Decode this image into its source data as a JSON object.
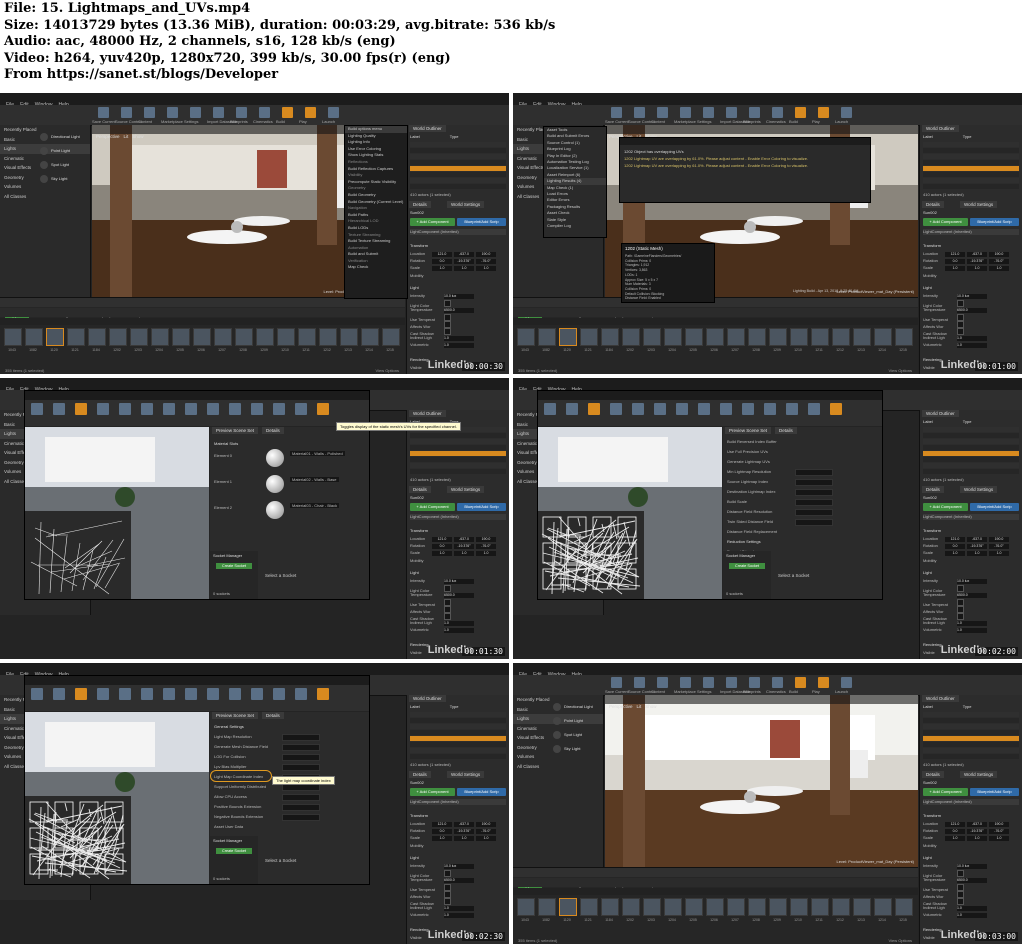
{
  "header": {
    "file": "File: 15. Lightmaps_and_UVs.mp4",
    "size": "Size: 14013729 bytes (13.36 MiB), duration: 00:03:29, avg.bitrate: 536 kb/s",
    "audio": "Audio: aac, 48000 Hz, 2 channels, s16, 128 kb/s (eng)",
    "video": "Video: h264, yuv420p, 1280x720, 399 kb/s, 30.00 fps(r) (eng)",
    "source": "From https://sanet.st/blogs/Developer"
  },
  "common": {
    "menu": [
      "File",
      "Edit",
      "Window",
      "Help"
    ],
    "toolbar_labels": [
      "Save Current",
      "Source Control",
      "Content",
      "Marketplace",
      "Settings",
      "Import Datasmith",
      "Blueprints",
      "Cinematics",
      "Build",
      "Play",
      "Launch"
    ],
    "left_categories": [
      "Recently Placed",
      "Basic",
      "Lights",
      "Cinematic",
      "Visual Effects",
      "Geometry",
      "Volumes",
      "All Classes"
    ],
    "light_items": [
      "Directional Light",
      "Point Light",
      "Spot Light",
      "Sky Light"
    ],
    "viewport_tabs": [
      "Perspective",
      "Lit",
      "Show"
    ],
    "level_label": "Level:  ProductViewer_mat_Day (Persistent)",
    "content_tabs": [
      "Content Browser",
      "Output Log"
    ],
    "cb_buttons": [
      "Add New",
      "Import",
      "Save All"
    ],
    "cb_path": [
      "Content",
      "neFlanders",
      "Geometries"
    ],
    "filters": "Filters",
    "items_status": "355 items (1 selected)",
    "view_options": "View Options",
    "asset_labels": [
      "1043",
      "1082",
      "1120",
      "1121",
      "1184",
      "1202",
      "1203",
      "1204",
      "1205",
      "1206",
      "1207",
      "1208",
      "1209",
      "1210",
      "1211",
      "1212",
      "1213",
      "1214",
      "1215"
    ],
    "world_outliner": "World Outliner",
    "outliner_cols": [
      "Label",
      "Type"
    ],
    "details_tab": "Details",
    "world_settings": "World Settings",
    "sun_label": "Sun002",
    "add_component": "+ Add Component",
    "blueprint_script": "Blueprint/Add Scrip",
    "light_component": "LightComponent (Inherited)",
    "transform": "Transform",
    "location": "Location",
    "rotation": "Rotation",
    "scale": "Scale",
    "mobility": "Mobility",
    "light": "Light",
    "intensity": "Intensity",
    "light_color": "Light Color",
    "temperature": "Temperature",
    "use_temperature": "Use Temperat",
    "affects_world": "Affects Wor",
    "cast_shadows": "Cast Shadow",
    "indirect_light": "Indirect Ligh",
    "volumetric": "Volumetric",
    "rendering": "Rendering",
    "visible": "Visible",
    "actors_count": "410 actors (1 selected)",
    "values": {
      "loc": [
        "121.0",
        "-637.0",
        "190.0"
      ],
      "rot": [
        "0.0",
        "-19.376°",
        "-76.0°"
      ],
      "scl": [
        "1.0",
        "1.0",
        "1.0"
      ],
      "intensity": "10.0 lux",
      "temperature": "6500.0",
      "indirect": "1.0",
      "volumetric": "1.0"
    },
    "linkedin": "LinkedIn"
  },
  "frames": [
    {
      "timestamp": "00:00:30",
      "build_menu": [
        "Build options menu",
        "Lighting Quality",
        "Lighting Info",
        "Use Error Coloring",
        "Show Lighting Stats",
        "Reflections",
        "Build Reflection Captures",
        "Visibility",
        "Precompute Static Visibility",
        "Geometry",
        "Build Geometry",
        "Build Geometry (Current Level)",
        "Navigation",
        "Build Paths",
        "Hierarchical LOD",
        "Build LODs",
        "Texture Streaming",
        "Build Texture Streaming",
        "Automation",
        "Build and Submit",
        "Verification",
        "Map Check"
      ]
    },
    {
      "timestamp": "00:01:00",
      "window_menu": [
        "Asset Tools",
        "Build and Submit Errors",
        "Source Control (1)",
        "Blueprint Log",
        "Play In Editor (2)",
        "Automation Testing Log",
        "Localization Service (1)",
        "Asset Reimport (6)",
        "Lighting Results (4)",
        "Map Check (1)",
        "Load Errors",
        "Editor Errors",
        "Packaging Results",
        "Asset Check",
        "Slate Style",
        "Compiler Log"
      ],
      "log_lines": [
        "1202 Object has overlapping UVs",
        "1202 Lightmap UV are overlapping by 61.0%. Please adjust content - Enable Error Coloring to visualize.",
        "1202 Lightmap UV are overlapping by 61.0%. Please adjust content - Enable Error Coloring to visualize."
      ],
      "tooltip_title": "1202 (Static Mesh)",
      "tooltip_lines": [
        "Path: /Game/neFlanders/Geometries/",
        "Collision Prims: 0",
        "Triangles: 1,912",
        "Vertices: 3,863",
        "LODs: 1",
        "Approx Size: 5 x 5 x 7",
        "Num Materials: 3",
        "Collision Prims: 0",
        "Default Collision: Blocking",
        "Distance Field: Enabled"
      ],
      "lighting_build": "Lighting Build - Apr 13, 2018, 9:23:40 AM"
    },
    {
      "timestamp": "00:01:30",
      "sme_title": "1202",
      "sme_tabs": [
        "Preview Scene Set",
        "Details"
      ],
      "toggle_tip": "Toggles display of the static mesh's UVs for the specified channel.",
      "material_slots": "Material Slots",
      "element_labels": [
        "Element 0",
        "Element 1",
        "Element 2"
      ],
      "material_names": [
        "Material01 - Walls - Polished",
        "Material02 - Walls - Base",
        "Material03 - Chair - Black"
      ],
      "socket_manager": "Socket Manager",
      "create_socket": "Create Socket",
      "select_socket": "Select a Socket",
      "sockets": "0 sockets"
    },
    {
      "timestamp": "00:02:00",
      "props": [
        "Build Reversed Index Buffer",
        "Use Full Precision UVs",
        "Generate Lightmap UVs",
        "Min Lightmap Resolution",
        "Source Lightmap Index",
        "Destination Lightmap Index",
        "Build Scale",
        "Distance Field Resolution",
        "Twin Sided Distance Field",
        "Distance Field Replacement",
        "Reduction Settings",
        "Percent Triangles"
      ],
      "vals": [
        "64",
        "0",
        "1",
        "1.0",
        "1.0",
        "None"
      ]
    },
    {
      "timestamp": "00:02:30",
      "props": [
        "General Settings",
        "Light Map Resolution",
        "Generate Mesh Distance Field",
        "LOD For Collision",
        "Lpv Bias Multiplier",
        "Light Map Coordinate Index",
        "Support Uniformly Distributed",
        "Allow CPU Access",
        "Positive Bounds Extension",
        "Negative Bounds Extension",
        "Asset User Data"
      ],
      "tip": "The light map coordinate index",
      "vals": [
        "512",
        "0",
        "1.0",
        "1"
      ]
    },
    {
      "timestamp": "00:03:00"
    }
  ]
}
